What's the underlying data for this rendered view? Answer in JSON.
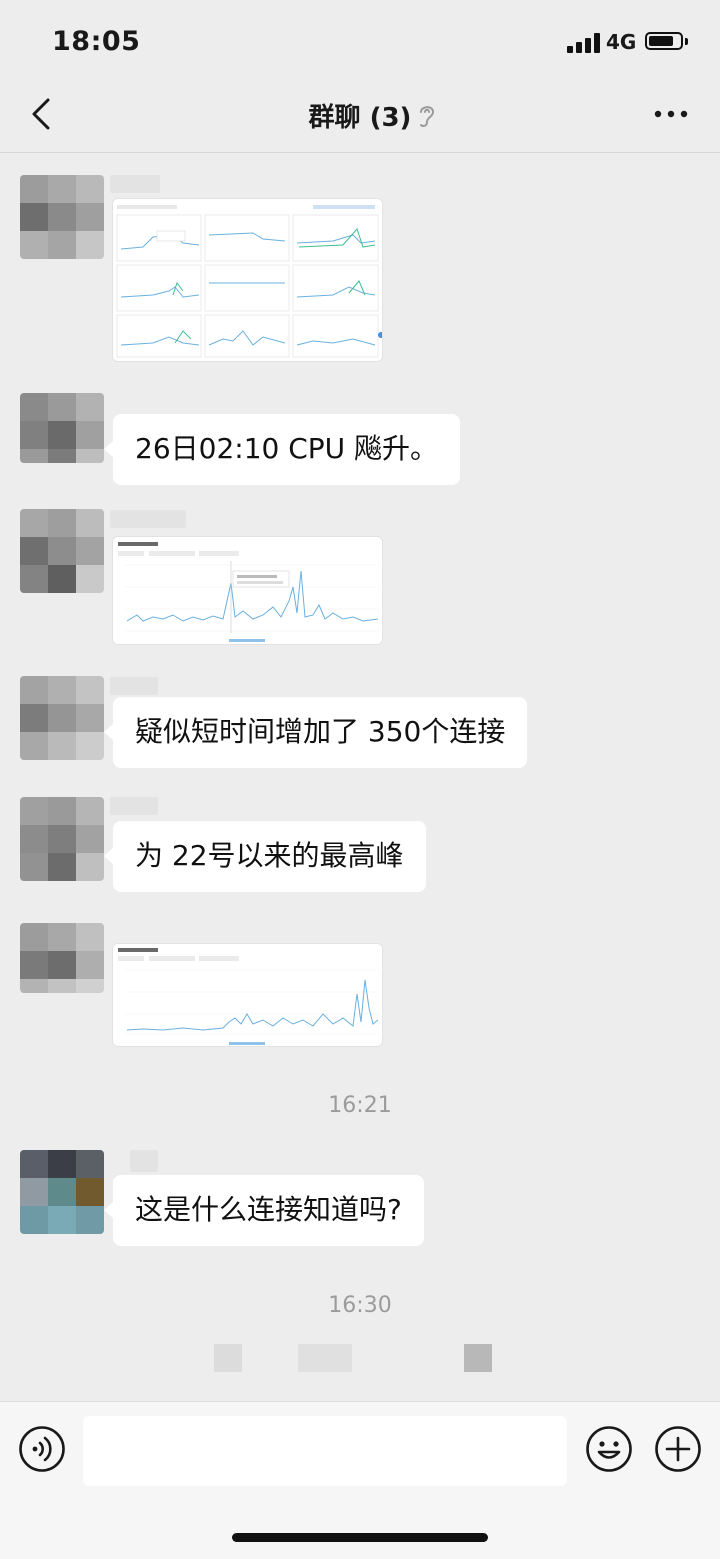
{
  "status_bar": {
    "time": "18:05",
    "network": "4G"
  },
  "nav": {
    "title": "群聊 (3)"
  },
  "messages": [
    {
      "type": "image",
      "desc": "dashboard-grid"
    },
    {
      "type": "text",
      "text": "26日02:10 CPU 飚升。"
    },
    {
      "type": "image",
      "desc": "connection-chart-spike"
    },
    {
      "type": "text",
      "text": "疑似短时间增加了 350个连接"
    },
    {
      "type": "text",
      "text": "为 22号以来的最高峰"
    },
    {
      "type": "image",
      "desc": "connection-chart-trend"
    },
    {
      "type": "text",
      "text": "这是什么连接知道吗?"
    }
  ],
  "timestamps": [
    "16:21",
    "16:30"
  ],
  "input": {
    "placeholder": ""
  },
  "colors": {
    "background": "#ededed",
    "bubble": "#ffffff",
    "chart_line": "#6ab0de",
    "chart_green": "#3cbf8e"
  },
  "icons": [
    "back-chevron-icon",
    "ear-icon",
    "more-icon",
    "voice-icon",
    "emoji-icon",
    "plus-icon"
  ]
}
